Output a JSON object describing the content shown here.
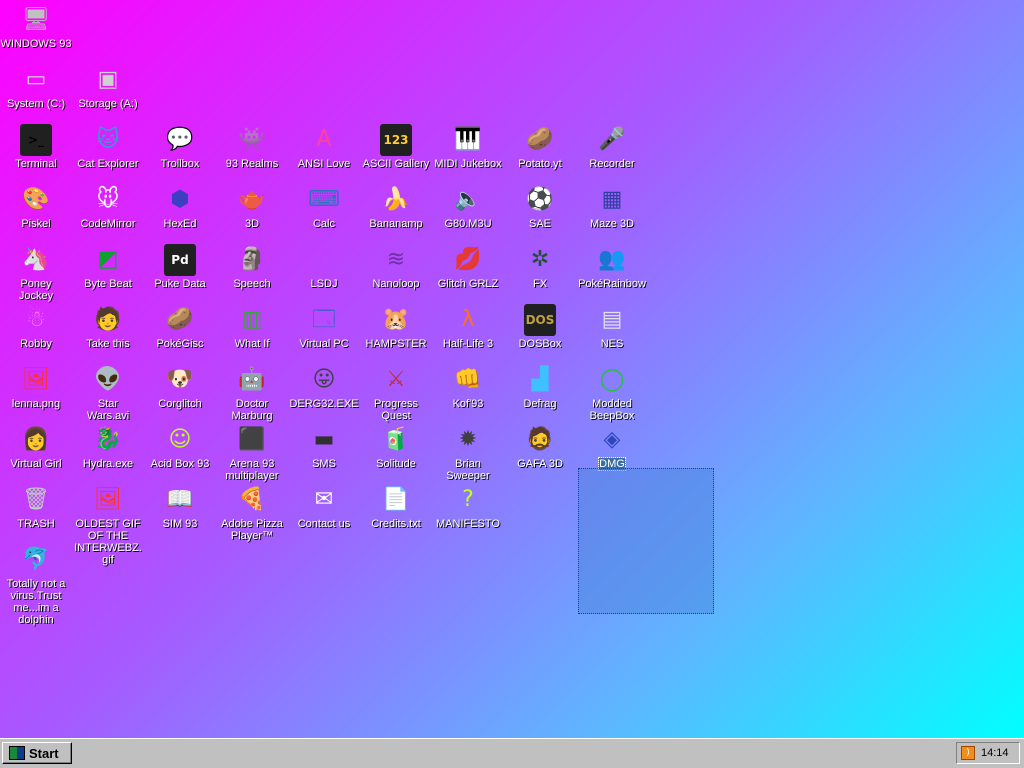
{
  "desktop": {
    "icons": [
      {
        "label": "WINDOWS 93",
        "glyph": "🖥",
        "color": "#c0c0c0"
      },
      {
        "label": "System (C:)",
        "glyph": "▭",
        "color": "#d0d0d0"
      },
      {
        "label": "Storage (A:)",
        "glyph": "▣",
        "color": "#d0d0d0"
      },
      {
        "label": "Terminal",
        "glyph": ">_",
        "color": "#000000"
      },
      {
        "label": "Cat Explorer",
        "glyph": "🐱",
        "color": "#2aa0d8"
      },
      {
        "label": "Trollbox",
        "glyph": "💬",
        "color": "#35c0ff"
      },
      {
        "label": "93 Realms",
        "glyph": "👾",
        "color": "#d32020"
      },
      {
        "label": "ANSI Love",
        "glyph": "A",
        "color": "#ff3fa0"
      },
      {
        "label": "ASCII Gallery",
        "glyph": "123",
        "color": "#ffcc33"
      },
      {
        "label": "MIDI Jukebox",
        "glyph": "🎹",
        "color": "#ffffff"
      },
      {
        "label": "Potato.yt",
        "glyph": "🥔",
        "color": "#c89050"
      },
      {
        "label": "Recorder",
        "glyph": "🎤",
        "color": "#909090"
      },
      {
        "label": "Piskel",
        "glyph": "🎨",
        "color": "#f0c040"
      },
      {
        "label": "CodeMirror",
        "glyph": "🐭",
        "color": "#ffffff"
      },
      {
        "label": "HexEd",
        "glyph": "⬢",
        "color": "#3a40c0"
      },
      {
        "label": "3D",
        "glyph": "🫖",
        "color": "#ffb0d0"
      },
      {
        "label": "Calc",
        "glyph": "⌨",
        "color": "#3070c0"
      },
      {
        "label": "Bananamp",
        "glyph": "🍌",
        "color": "#ffe040"
      },
      {
        "label": "G80.M3U",
        "glyph": "🔈",
        "color": "#ffffff"
      },
      {
        "label": "SAE",
        "glyph": "⚽",
        "color": "#ff2030"
      },
      {
        "label": "Maze 3D",
        "glyph": "▦",
        "color": "#3040a0"
      },
      {
        "label": "Poney\nJockey",
        "glyph": "🦄",
        "color": "#c070ff"
      },
      {
        "label": "Byte Beat",
        "glyph": "◩",
        "color": "#10a030"
      },
      {
        "label": "Puke Data",
        "glyph": "Pd",
        "color": "#ffffff"
      },
      {
        "label": "Speech",
        "glyph": "🗿",
        "color": "#d0d0d0"
      },
      {
        "label": "LSDJ",
        "glyph": "♬",
        "color": "#c040ff"
      },
      {
        "label": "Nanoloop",
        "glyph": "≋",
        "color": "#7030a0"
      },
      {
        "label": "Glitch GRLZ",
        "glyph": "💋",
        "color": "#ff3050"
      },
      {
        "label": "FX",
        "glyph": "✲",
        "color": "#205030"
      },
      {
        "label": "PokéRainbow",
        "glyph": "👥",
        "color": "#509050"
      },
      {
        "label": "Robby",
        "glyph": "☃",
        "color": "#ff80ff"
      },
      {
        "label": "Take this",
        "glyph": "🧑",
        "color": "#ff8030"
      },
      {
        "label": "PokéGisc",
        "glyph": "🥔",
        "color": "#a06030"
      },
      {
        "label": "What If",
        "glyph": "▥",
        "color": "#40a040"
      },
      {
        "label": "Virtual PC",
        "glyph": "🗔",
        "color": "#4060c0"
      },
      {
        "label": "HAMPSTER",
        "glyph": "🐹",
        "color": "#ffffff"
      },
      {
        "label": "Half-Life 3",
        "glyph": "λ",
        "color": "#ff7010"
      },
      {
        "label": "DOSBox",
        "glyph": "DOS",
        "color": "#c0a040"
      },
      {
        "label": "NES",
        "glyph": "▤",
        "color": "#e0e0e0"
      },
      {
        "label": "lenna.png",
        "glyph": "🖼",
        "color": "#ff3030"
      },
      {
        "label": "Star\nWars.avi",
        "glyph": "👽",
        "color": "#40a040"
      },
      {
        "label": "Corglitch",
        "glyph": "🐶",
        "color": "#e09040"
      },
      {
        "label": "Doctor\nMarburg",
        "glyph": "🤖",
        "color": "#e0e0e0"
      },
      {
        "label": "DERG32.EXE",
        "glyph": "😛",
        "color": "#404040"
      },
      {
        "label": "Progress\nQuest",
        "glyph": "⚔",
        "color": "#c03030"
      },
      {
        "label": "Kof'93",
        "glyph": "👊",
        "color": "#ff9090"
      },
      {
        "label": "Defrag",
        "glyph": "▟",
        "color": "#40c0ff"
      },
      {
        "label": "Modded\nBeepBox",
        "glyph": "◯",
        "color": "#20c040"
      },
      {
        "label": "Virtual Girl",
        "glyph": "👩",
        "color": "#ffc0a0"
      },
      {
        "label": "Hydra.exe",
        "glyph": "🐉",
        "color": "#30a050"
      },
      {
        "label": "Acid Box 93",
        "glyph": "☺",
        "color": "#c0ff20"
      },
      {
        "label": "Arena 93\nmultiplayer",
        "glyph": "⬛",
        "color": "#40c0c0"
      },
      {
        "label": "SMS",
        "glyph": "▬",
        "color": "#303030"
      },
      {
        "label": "Solitude",
        "glyph": "🧃",
        "color": "#40c0a0"
      },
      {
        "label": "Brian\nSweeper",
        "glyph": "✹",
        "color": "#404040"
      },
      {
        "label": "GAFA 3D",
        "glyph": "🧔",
        "color": "#c08040"
      },
      {
        "label": "DMG",
        "glyph": "◈",
        "color": "#2060e0"
      },
      {
        "label": "TRASH",
        "glyph": "🗑",
        "color": "#c0d0c0"
      },
      {
        "label": "OLDEST GIF\nOF THE\nINTERWEBZ.\ngif",
        "glyph": "🖼",
        "color": "#ff3030"
      },
      {
        "label": "SIM 93",
        "glyph": "📖",
        "color": "#ffffff"
      },
      {
        "label": "Adobe Pizza\nPlayer™",
        "glyph": "🍕",
        "color": "#ffd080"
      },
      {
        "label": "Contact us",
        "glyph": "✉",
        "color": "#ffffff"
      },
      {
        "label": "Credits.txt",
        "glyph": "📄",
        "color": "#ffffff"
      },
      {
        "label": "MANIFESTO",
        "glyph": "?",
        "color": "#c0ff20"
      },
      {
        "label": "Totally not a\nvirus.Trust\nme...im a\ndolphin",
        "glyph": "🐬",
        "color": "#60c0e0"
      }
    ],
    "selected_icon": "DMG"
  },
  "taskbar": {
    "start_label": "Start",
    "clock": "14:14",
    "tray_icon": "rss-icon"
  },
  "colors": {
    "gradient_start": "#ff00ff",
    "gradient_end": "#00ffff",
    "taskbar": "#c0c0c0",
    "selection": "#3a6ea5"
  }
}
